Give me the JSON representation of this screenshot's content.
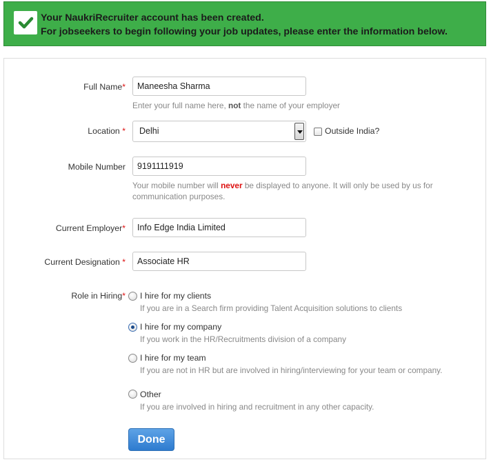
{
  "banner": {
    "line1": "Your NaukriRecruiter account has been created.",
    "line2": "For jobseekers to begin following your job updates, please enter the information below.",
    "icon": "checkmark-icon",
    "color": "#3eae49"
  },
  "form": {
    "full_name": {
      "label": "Full Name",
      "value": "Maneesha Sharma",
      "hint_pre": "Enter your full name here, ",
      "hint_bold": "not",
      "hint_post": " the name of your employer"
    },
    "location": {
      "label": "Location ",
      "value": "Delhi",
      "outside_label": "Outside India?"
    },
    "mobile": {
      "label": "Mobile Number",
      "value": "9191111919",
      "hint_pre": "Your mobile number will ",
      "hint_never": "never",
      "hint_post": " be displayed to anyone. It will only be used by us for",
      "hint_line2": "communication purposes."
    },
    "employer": {
      "label": "Current Employer",
      "value": "Info Edge India Limited"
    },
    "designation": {
      "label": "Current Designation ",
      "value": "Associate HR"
    },
    "role": {
      "label": "Role in Hiring",
      "options": [
        {
          "label": "I hire for my clients",
          "desc": "If you are in a Search firm providing Talent Acquisition solutions to clients",
          "checked": false
        },
        {
          "label": "I hire for my company",
          "desc": "If you work in the HR/Recruitments division of a company",
          "checked": true
        },
        {
          "label": "I hire for my team",
          "desc": "If you are not in HR but are involved in hiring/interviewing for your team or company.",
          "checked": false
        },
        {
          "label": "Other",
          "desc": "If you are involved in hiring and recruitment in any other capacity.",
          "checked": false
        }
      ]
    },
    "required_mark": "*",
    "done_label": "Done"
  }
}
